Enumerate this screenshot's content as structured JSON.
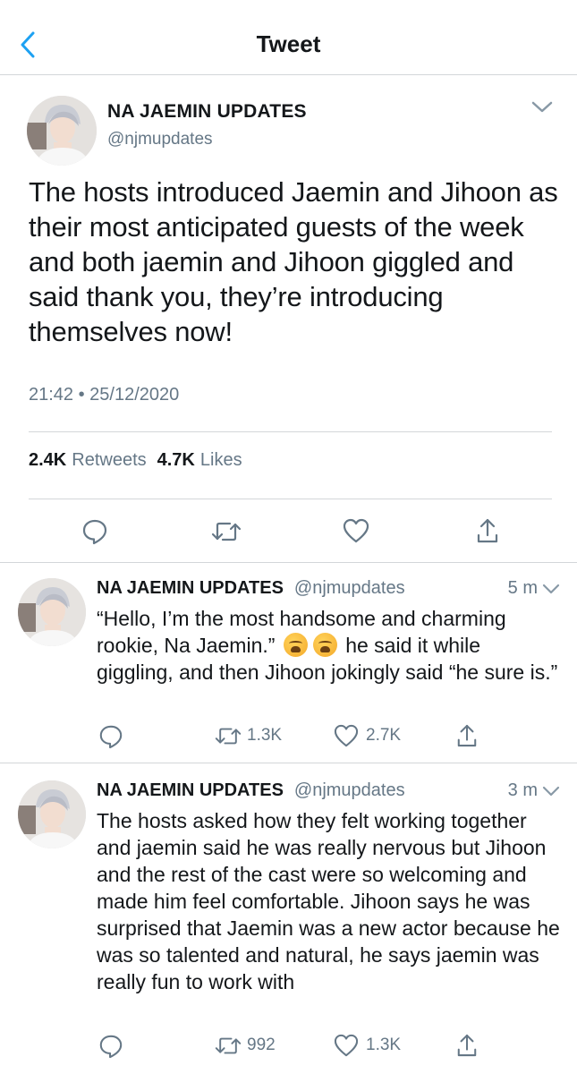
{
  "nav": {
    "title": "Tweet",
    "back_icon": "chevron-left-icon"
  },
  "colors": {
    "accent": "#1da1f2",
    "text": "#14171a",
    "secondary": "#657786",
    "divider": "#d3d6d9"
  },
  "main_tweet": {
    "name": "NA JAEMIN UPDATES",
    "handle": "@njmupdates",
    "text": "The hosts introduced Jaemin and Jihoon as their most anticipated guests of the week and both jaemin and Jihoon giggled and said thank you, they’re introducing themselves now!",
    "time": "21:42 • 25/12/2020",
    "retweets": {
      "count": "2.4K",
      "label": "Retweets"
    },
    "likes": {
      "count": "4.7K",
      "label": "Likes"
    }
  },
  "replies": [
    {
      "name": "NA JAEMIN UPDATES",
      "handle": "@njmupdates",
      "time": "5 m",
      "text_before": "“Hello, I’m the most handsome and charming rookie, Na Jaemin.”",
      "emojis": [
        "weary-face-emoji",
        "weary-face-emoji"
      ],
      "text_after": "he said it while giggling, and then Jihoon jokingly said “he sure is.”",
      "retweets": "1.3K",
      "likes": "2.7K"
    },
    {
      "name": "NA JAEMIN UPDATES",
      "handle": "@njmupdates",
      "time": "3 m",
      "text": "The hosts asked how they felt working together and jaemin said he was really nervous but Jihoon and the rest of the cast were so welcoming and made him feel comfortable. Jihoon says he was surprised that Jaemin was a new actor because he was so talented and natural, he says jaemin was really fun to work with",
      "retweets": "992",
      "likes": "1.3K"
    }
  ]
}
